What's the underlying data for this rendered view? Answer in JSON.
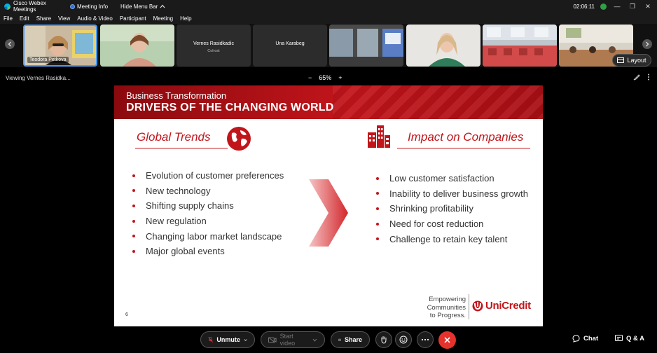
{
  "titlebar": {
    "app_name": "Cisco Webex Meetings",
    "meeting_info": "Meeting Info",
    "hide_menu": "Hide Menu Bar",
    "clock": "02:06:11",
    "minimize": "—",
    "restore": "❐",
    "close": "✕"
  },
  "menu": {
    "items": [
      "File",
      "Edit",
      "Share",
      "View",
      "Audio & Video",
      "Participant",
      "Meeting",
      "Help"
    ]
  },
  "filmstrip": {
    "participants": [
      {
        "name": "Teodora Petkova",
        "sub": ""
      },
      {
        "name": "",
        "sub": ""
      },
      {
        "name": "Vernes Rasidkadic",
        "sub": "Cohost"
      },
      {
        "name": "Una Karabeg",
        "sub": ""
      },
      {
        "name": "",
        "sub": ""
      },
      {
        "name": "",
        "sub": ""
      },
      {
        "name": "",
        "sub": ""
      },
      {
        "name": "",
        "sub": ""
      }
    ],
    "layout_label": "Layout"
  },
  "viewbar": {
    "viewing": "Viewing Vernes Rasidka...",
    "zoom": "65%",
    "zoom_minus": "−",
    "zoom_plus": "+"
  },
  "slide": {
    "subtitle": "Business Transformation",
    "title": "DRIVERS OF THE CHANGING WORLD",
    "left_heading": "Global Trends",
    "left_items": [
      "Evolution of customer preferences",
      "New technology",
      "Shifting supply chains",
      "New regulation",
      "Changing labor market landscape",
      "Major global events"
    ],
    "right_heading": "Impact on Companies",
    "right_items": [
      "Low customer satisfaction",
      "Inability to deliver business growth",
      "Shrinking profitability",
      "Need for cost reduction",
      "Challenge to retain key talent"
    ],
    "page_number": "6",
    "tagline": [
      "Empowering",
      "Communities",
      "to Progress."
    ],
    "brand": "UniCredit"
  },
  "toolbar": {
    "unmute": "Unmute",
    "start_video": "Start video",
    "share": "Share",
    "chat": "Chat",
    "qa": "Q & A"
  },
  "colors": {
    "brand_red": "#c2151b",
    "end_call": "#e5322d",
    "active_tile": "#4a9bff"
  }
}
